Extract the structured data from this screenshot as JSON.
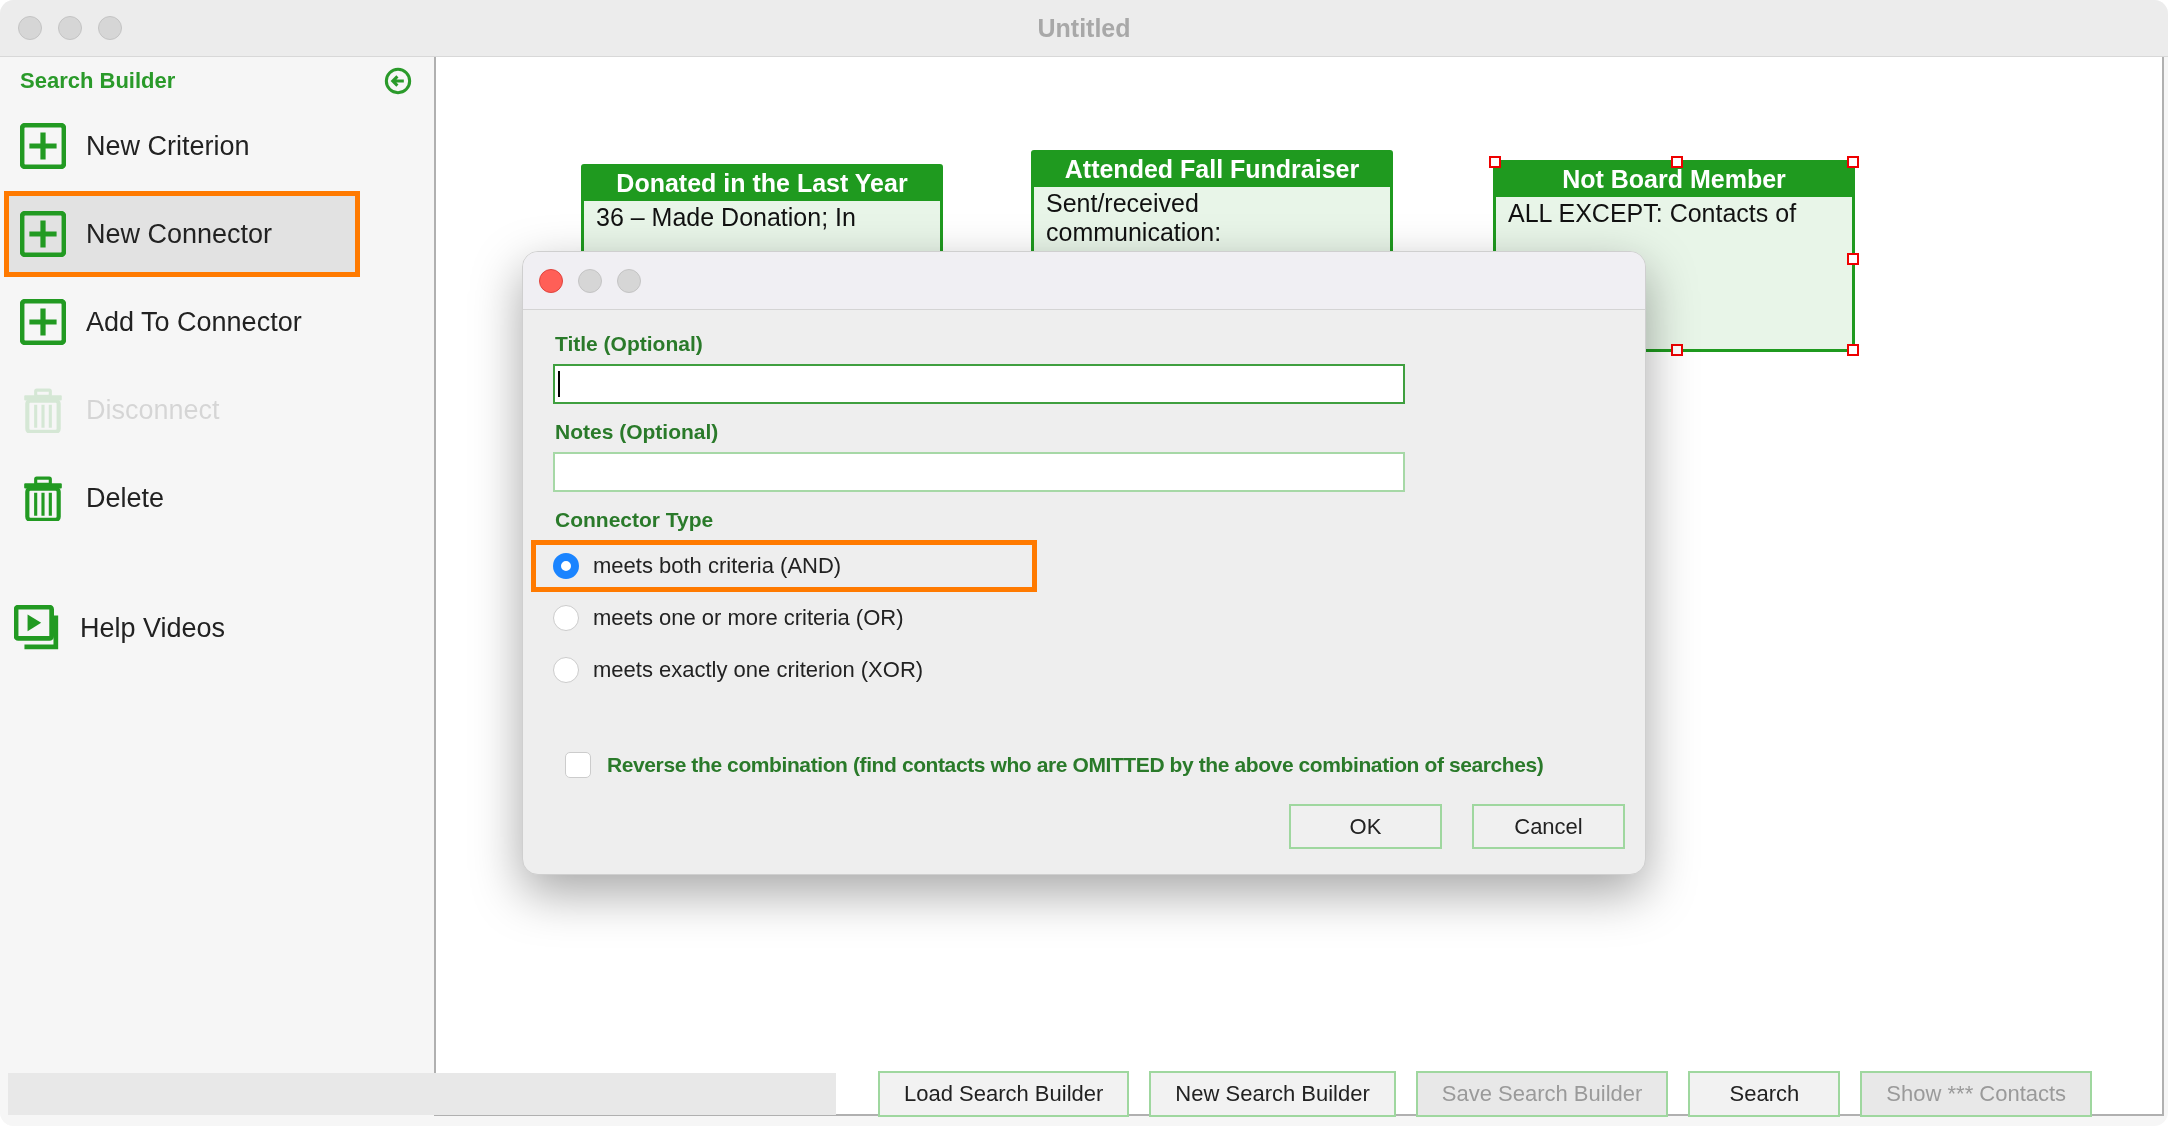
{
  "window": {
    "title": "Untitled"
  },
  "sidebar": {
    "title": "Search Builder",
    "items": [
      {
        "label": "New Criterion",
        "kind": "add",
        "disabled": false,
        "highlighted": false,
        "annotated": false
      },
      {
        "label": "New Connector",
        "kind": "add",
        "disabled": false,
        "highlighted": true,
        "annotated": true
      },
      {
        "label": "Add To Connector",
        "kind": "add",
        "disabled": false,
        "highlighted": false,
        "annotated": false
      },
      {
        "label": "Disconnect",
        "kind": "trash",
        "disabled": true,
        "highlighted": false,
        "annotated": false
      },
      {
        "label": "Delete",
        "kind": "trash",
        "disabled": false,
        "highlighted": false,
        "annotated": false
      },
      {
        "label": "Help Videos",
        "kind": "video",
        "disabled": false,
        "highlighted": false,
        "annotated": false
      }
    ]
  },
  "canvas": {
    "cards": [
      {
        "title": "Donated in the Last Year",
        "lines": [
          "36 – Made Donation; In"
        ],
        "selected": false
      },
      {
        "title": "Attended Fall Fundraiser",
        "lines": [
          "Sent/received",
          "communication:"
        ],
        "selected": false
      },
      {
        "title": "Not Board Member",
        "lines": [
          "ALL EXCEPT: Contacts of"
        ],
        "selected": true
      }
    ]
  },
  "dialog": {
    "fields": [
      {
        "label": "Title (Optional)",
        "focused": true
      },
      {
        "label": "Notes (Optional)",
        "focused": false
      }
    ],
    "group_label": "Connector Type",
    "options": [
      {
        "label": "meets both criteria (AND)",
        "selected": true,
        "annotated": true
      },
      {
        "label": "meets one or more criteria (OR)",
        "selected": false,
        "annotated": false
      },
      {
        "label": "meets exactly one criterion (XOR)",
        "selected": false,
        "annotated": false
      }
    ],
    "reverse": {
      "label": "Reverse the combination (find contacts who are OMITTED by the above combination of searches)",
      "checked": false
    },
    "buttons": [
      "OK",
      "Cancel"
    ]
  },
  "bottom_bar": {
    "buttons": [
      {
        "label": "Load Search Builder",
        "disabled": false
      },
      {
        "label": "New Search Builder",
        "disabled": false
      },
      {
        "label": "Save Search Builder",
        "disabled": true
      },
      {
        "label": "Search",
        "disabled": false
      },
      {
        "label": "Show *** Contacts",
        "disabled": true
      }
    ]
  }
}
